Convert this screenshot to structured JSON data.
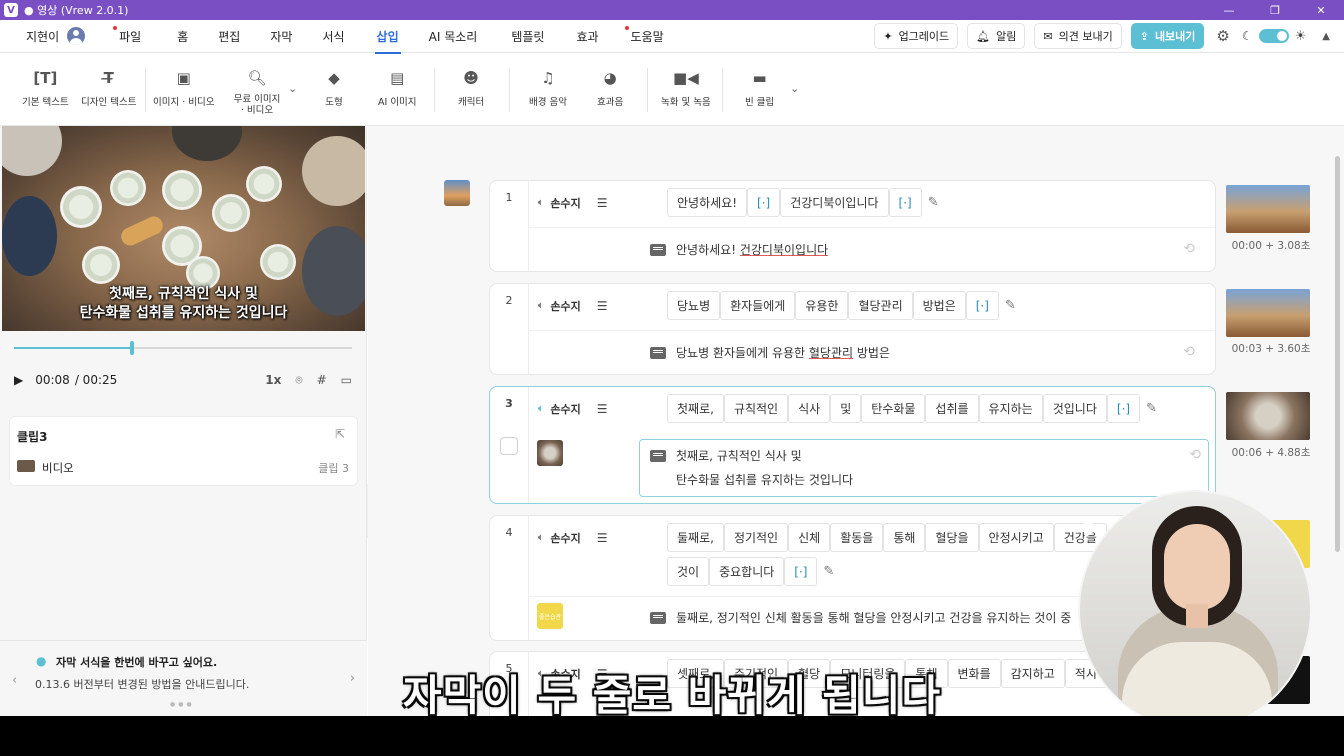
{
  "window": {
    "title": "● 영상 (Vrew 2.0.1)",
    "logo": "V"
  },
  "menubar": {
    "user_name": "지현이",
    "items": [
      {
        "label": "파일",
        "dot": true
      },
      {
        "label": "홈",
        "dot": false
      },
      {
        "label": "편집",
        "dot": false
      },
      {
        "label": "자막",
        "dot": false
      },
      {
        "label": "서식",
        "dot": false
      },
      {
        "label": "삽입",
        "dot": false,
        "active": true
      },
      {
        "label": "AI 목소리",
        "dot": false
      },
      {
        "label": "템플릿",
        "dot": false
      },
      {
        "label": "효과",
        "dot": false
      },
      {
        "label": "도움말",
        "dot": true
      }
    ],
    "upgrade_label": "업그레이드",
    "notify_label": "알림",
    "feedback_label": "의견 보내기",
    "export_label": "내보내기"
  },
  "toolbar": {
    "tools": [
      {
        "label": "기본 텍스트",
        "icon": "text-box-icon"
      },
      {
        "label": "디자인 텍스트",
        "icon": "design-text-icon"
      },
      {
        "label": "이미지 · 비디오",
        "icon": "image-icon"
      },
      {
        "label": "무료 이미지 · 비디오",
        "icon": "image-search-icon"
      },
      {
        "label": "도형",
        "icon": "shapes-icon"
      },
      {
        "label": "AI 이미지",
        "icon": "ai-image-icon"
      },
      {
        "label": "캐릭터",
        "icon": "character-icon"
      },
      {
        "label": "배경 음악",
        "icon": "music-note-icon"
      },
      {
        "label": "효과음",
        "icon": "sound-effect-icon"
      },
      {
        "label": "녹화 및 녹음",
        "icon": "video-camera-icon"
      },
      {
        "label": "빈 클립",
        "icon": "blank-clip-icon"
      }
    ]
  },
  "player": {
    "subtitle_line1": "첫째로, 규칙적인 식사 및",
    "subtitle_line2": "탄수화물 섭취를 유지하는 것입니다",
    "current_time": "00:08",
    "total_time": "/ 00:25",
    "speed": "1x",
    "progress": 0.35
  },
  "clip_panel": {
    "title": "클립3",
    "row_label": "비디오",
    "row_tag": "클립 3"
  },
  "tip": {
    "title": "자막 서식을 한번에 바꾸고 싶어요.",
    "body": "0.13.6 버전부터 변경된 방법을 안내드립니다."
  },
  "clips": [
    {
      "num": "1",
      "speaker": "손수지",
      "words": [
        "안녕하세요!",
        "[·]",
        "건강디북이입니다",
        "[·]"
      ],
      "subtitle": [
        "안녕하세요! ",
        "건강디북이입니다"
      ],
      "time": "00:00 + 3.08초"
    },
    {
      "num": "2",
      "speaker": "손수지",
      "words": [
        "당뇨병",
        "환자들에게",
        "유용한",
        "혈당관리",
        "방법은",
        "[·]"
      ],
      "subtitle": [
        "당뇨병 환자들에게 유용한 ",
        "혈당관리",
        " 방법은"
      ],
      "time": "00:03 + 3.60초"
    },
    {
      "num": "3",
      "speaker": "손수지",
      "words": [
        "첫째로,",
        "규칙적인",
        "식사",
        "및",
        "탄수화물",
        "섭취를",
        "유지하는",
        "것입니다",
        "[·]"
      ],
      "subtitle_line1": "첫째로, 규칙적인 식사 및",
      "subtitle_line2": "탄수화물 섭취를 유지하는 것입니다",
      "time": "00:06 + 4.88초"
    },
    {
      "num": "4",
      "speaker": "손수지",
      "words": [
        "둘째로,",
        "정기적인",
        "신체",
        "활동을",
        "통해",
        "혈당을",
        "안정시키고",
        "건강을"
      ],
      "words2": [
        "것이",
        "중요합니다",
        "[·]"
      ],
      "subtitle": "둘째로, 정기적인 신체 활동을 통해 혈당을 안정시키고 건강을 유지하는 것이 중",
      "image_label": "좋은습관"
    },
    {
      "num": "5",
      "speaker": "손수지",
      "words": [
        "셋째로,",
        "주기적인",
        "혈당",
        "모니터링을",
        "통해",
        "변화를",
        "감지하고",
        "적시"
      ]
    }
  ],
  "overlay_caption": "자막이 두 줄로 바뀌게 됩니다",
  "colors": {
    "accent": "#5cbfd3",
    "title_bar": "#7b4fc4",
    "active_menu": "#2a6fd6"
  }
}
